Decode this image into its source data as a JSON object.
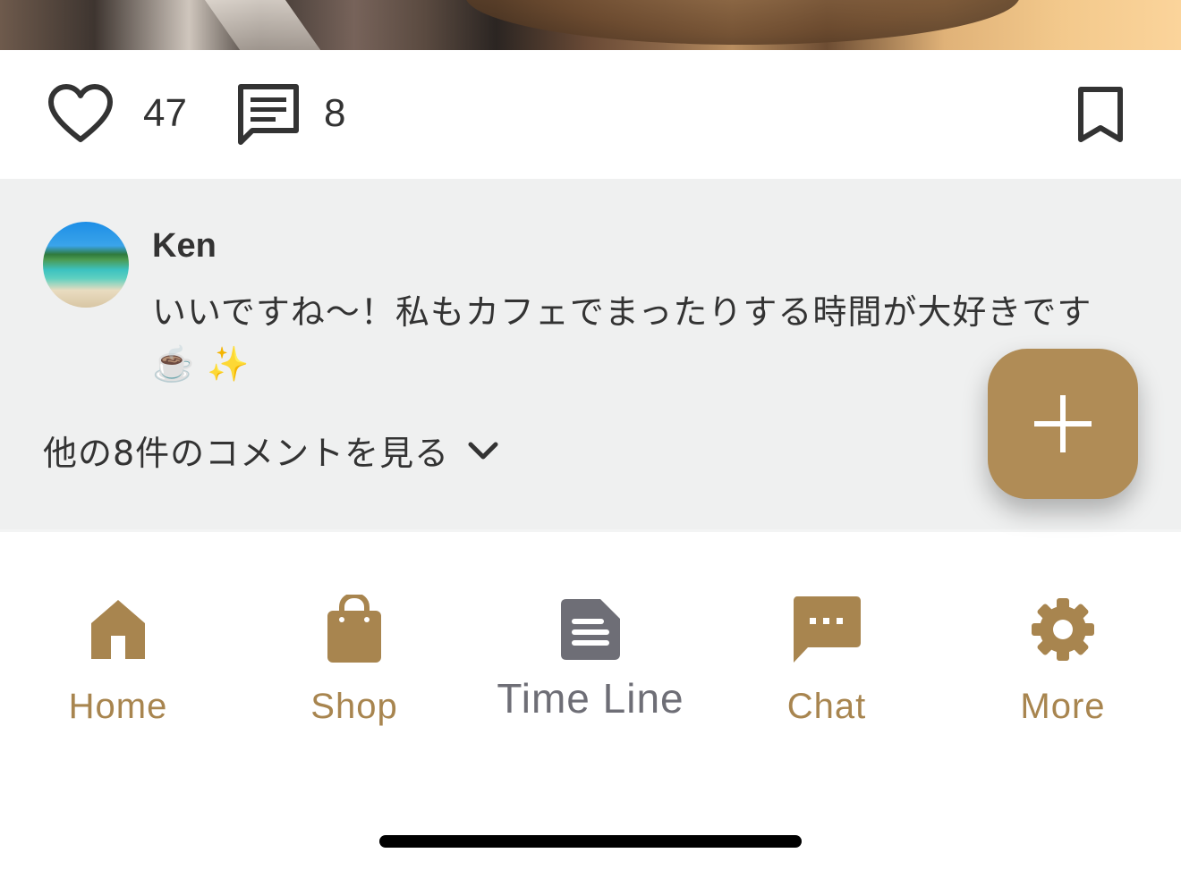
{
  "post": {
    "likes": "47",
    "comments": "8"
  },
  "comment": {
    "author": "Ken",
    "text": "いいですね〜！私もカフェでまったりする時間が大好きです☕️ ✨",
    "view_more": "他の8件のコメントを見る"
  },
  "nav": {
    "items": [
      {
        "label": "Home",
        "icon": "home-icon"
      },
      {
        "label": "Shop",
        "icon": "shopping-bag-icon"
      },
      {
        "label": "Time Line",
        "icon": "document-icon",
        "active": true
      },
      {
        "label": "Chat",
        "icon": "chat-icon"
      },
      {
        "label": "More",
        "icon": "gear-icon"
      }
    ]
  },
  "colors": {
    "accent": "#a8854f",
    "fab": "#b08c56",
    "active_tab": "#6e6e76",
    "comment_bg": "#eff0f0"
  }
}
